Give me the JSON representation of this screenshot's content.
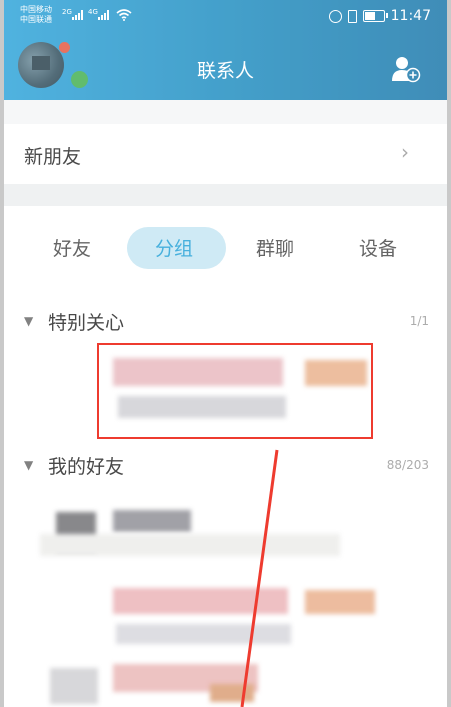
{
  "status_bar": {
    "carrier1": "中国移动",
    "carrier2": "中国联通",
    "net1": "2G",
    "net2": "4G",
    "time": "11:47",
    "icons": [
      "signal-icon",
      "wifi-icon",
      "alarm-icon",
      "vibrate-icon",
      "battery-icon"
    ]
  },
  "header": {
    "title": "联系人",
    "add_icon": "add-contact-icon"
  },
  "new_friends": {
    "label": "新朋友",
    "chevron": "›"
  },
  "tabs": [
    {
      "label": "好友",
      "active": false
    },
    {
      "label": "分组",
      "active": true
    },
    {
      "label": "群聊",
      "active": false
    },
    {
      "label": "设备",
      "active": false
    }
  ],
  "groups": [
    {
      "name": "特别关心",
      "count": "1/1",
      "collapse_icon": "triangle-down-icon"
    },
    {
      "name": "我的好友",
      "count": "88/203",
      "collapse_icon": "triangle-down-icon"
    }
  ],
  "colors": {
    "header_gradient_start": "#2aa2d9",
    "header_gradient_end": "#1574a8",
    "tab_active": "#1f9fd6",
    "annotation_red": "#ee3b2f"
  }
}
